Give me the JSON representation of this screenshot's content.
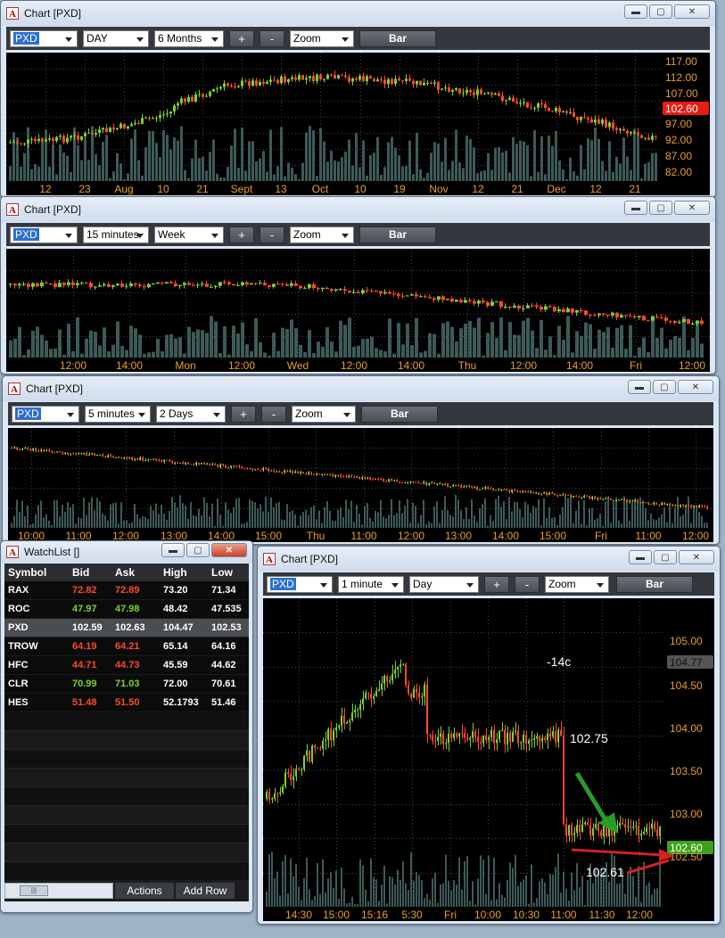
{
  "windows": [
    {
      "title": "Chart [PXD]",
      "symbol": "PXD",
      "interval": "DAY",
      "range": "6 Months",
      "plus": "+",
      "minus": "-",
      "zoom": "Zoom",
      "style": "Bar",
      "price_labels": [
        "117.00",
        "112.00",
        "107.00",
        "102.60",
        "97.00",
        "92.00",
        "87.00",
        "82.00"
      ],
      "last_price": "102.60",
      "x_labels": [
        "12",
        "23",
        "Aug",
        "10",
        "21",
        "Sept",
        "13",
        "Oct",
        "10",
        "19",
        "Nov",
        "12",
        "21",
        "Dec",
        "12",
        "21"
      ]
    },
    {
      "title": "Chart [PXD]",
      "symbol": "PXD",
      "interval": "15 minutes",
      "range": "Week",
      "plus": "+",
      "minus": "-",
      "zoom": "Zoom",
      "style": "Bar",
      "x_labels": [
        "12:00",
        "14:00",
        "Mon",
        "12:00",
        "Wed",
        "12:00",
        "14:00",
        "Thu",
        "12:00",
        "14:00",
        "Fri",
        "12:00"
      ]
    },
    {
      "title": "Chart [PXD]",
      "symbol": "PXD",
      "interval": "5 minutes",
      "range": "2 Days",
      "plus": "+",
      "minus": "-",
      "zoom": "Zoom",
      "style": "Bar",
      "x_labels": [
        "10:00",
        "11:00",
        "12:00",
        "13:00",
        "14:00",
        "15:00",
        "Thu",
        "11:00",
        "12:00",
        "13:00",
        "14:00",
        "15:00",
        "Fri",
        "11:00",
        "12:00"
      ]
    },
    {
      "title": "Chart [PXD]",
      "symbol": "PXD",
      "interval": "1 minute",
      "range": "Day",
      "plus": "+",
      "minus": "-",
      "zoom": "Zoom",
      "style": "Bar",
      "price_labels": [
        "105.00",
        "104.77",
        "104.50",
        "104.00",
        "103.50",
        "103.00",
        "102.60",
        "102.50"
      ],
      "last_price": "102.60",
      "high_marker": "104.77",
      "annotations": {
        "change": "-14c",
        "high": "102.75",
        "low": "102.61"
      },
      "x_labels": [
        "14:30",
        "15:00",
        "15:16",
        "5:30",
        "Fri",
        "10:00",
        "10:30",
        "11:00",
        "11:30",
        "12:00"
      ]
    }
  ],
  "watchlist": {
    "title": "WatchList []",
    "columns": [
      "Symbol",
      "Bid",
      "Ask",
      "High",
      "Low"
    ],
    "rows": [
      {
        "symbol": "RAX",
        "bid": "72.82",
        "ask": "72.89",
        "high": "73.20",
        "low": "71.34",
        "color": "#ff4a2a"
      },
      {
        "symbol": "ROC",
        "bid": "47.97",
        "ask": "47.98",
        "high": "48.42",
        "low": "47.535",
        "color": "#7ed321"
      },
      {
        "symbol": "PXD",
        "bid": "102.59",
        "ask": "102.63",
        "high": "104.47",
        "low": "102.53",
        "color": "#ffffff"
      },
      {
        "symbol": "TROW",
        "bid": "64.19",
        "ask": "64.21",
        "high": "65.14",
        "low": "64.16",
        "color": "#ff4a2a"
      },
      {
        "symbol": "HFC",
        "bid": "44.71",
        "ask": "44.73",
        "high": "45.59",
        "low": "44.62",
        "color": "#ff4a2a"
      },
      {
        "symbol": "CLR",
        "bid": "70.99",
        "ask": "71.03",
        "high": "72.00",
        "low": "70.61",
        "color": "#7ed321"
      },
      {
        "symbol": "HES",
        "bid": "51.48",
        "ask": "51.50",
        "high": "52.1793",
        "low": "51.46",
        "color": "#ff4a2a"
      }
    ],
    "actions_label": "Actions",
    "add_row_label": "Add Row"
  },
  "colors": {
    "up": "#7ed321",
    "down": "#ff4a2a",
    "volume": "#3d5a58",
    "grid": "#444444",
    "axis_text": "#e8a020",
    "last_price_bg": "#e81c12",
    "last_price_bg_green": "#3fa11a"
  }
}
